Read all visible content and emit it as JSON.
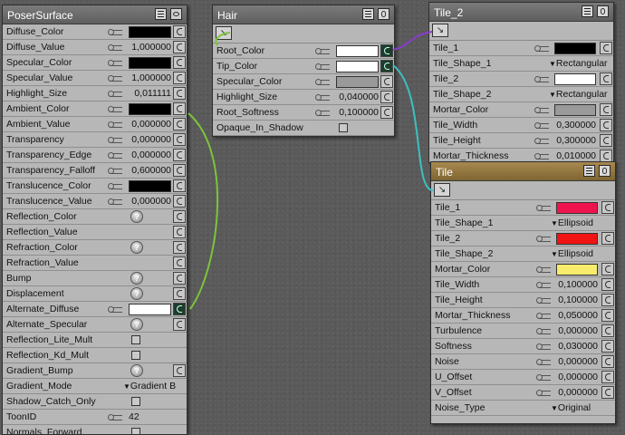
{
  "colors": {
    "wire_green": "#7cc43a",
    "wire_purple": "#8a3bd0",
    "wire_cyan": "#3cc0c0",
    "active_header": "#9a7d45"
  },
  "poser_surface": {
    "title": "PoserSurface",
    "rows": [
      {
        "label": "Diffuse_Color",
        "type": "color",
        "color": "#000000",
        "key": true,
        "port": true
      },
      {
        "label": "Diffuse_Value",
        "type": "number",
        "value": "1,000000",
        "key": true,
        "port": true
      },
      {
        "label": "Specular_Color",
        "type": "color",
        "color": "#000000",
        "key": true,
        "port": true
      },
      {
        "label": "Specular_Value",
        "type": "number",
        "value": "1,000000",
        "key": true,
        "port": true
      },
      {
        "label": "Highlight_Size",
        "type": "number",
        "value": "0,011111",
        "key": true,
        "port": true
      },
      {
        "label": "Ambient_Color",
        "type": "color",
        "color": "#000000",
        "key": true,
        "port": true
      },
      {
        "label": "Ambient_Value",
        "type": "number",
        "value": "0,000000",
        "key": true,
        "port": true
      },
      {
        "label": "Transparency",
        "type": "number",
        "value": "0,000000",
        "key": true,
        "port": true
      },
      {
        "label": "Transparency_Edge",
        "type": "number",
        "value": "0,000000",
        "key": true,
        "port": true
      },
      {
        "label": "Transparency_Falloff",
        "type": "number",
        "value": "0,600000",
        "key": true,
        "port": true
      },
      {
        "label": "Translucence_Color",
        "type": "color",
        "color": "#000000",
        "key": true,
        "port": true
      },
      {
        "label": "Translucence_Value",
        "type": "number",
        "value": "0,000000",
        "key": true,
        "port": true
      },
      {
        "label": "Reflection_Color",
        "type": "help",
        "port": true
      },
      {
        "label": "Reflection_Value",
        "type": "empty",
        "port": true
      },
      {
        "label": "Refraction_Color",
        "type": "help",
        "port": true
      },
      {
        "label": "Refraction_Value",
        "type": "empty",
        "port": true
      },
      {
        "label": "Bump",
        "type": "help",
        "port": true
      },
      {
        "label": "Displacement",
        "type": "help",
        "port": true
      },
      {
        "label": "Alternate_Diffuse",
        "type": "color",
        "color": "#ffffff",
        "key": true,
        "port": true,
        "connected": true
      },
      {
        "label": "Alternate_Specular",
        "type": "help",
        "port": true
      },
      {
        "label": "Reflection_Lite_Mult",
        "type": "checkbox"
      },
      {
        "label": "Reflection_Kd_Mult",
        "type": "checkbox"
      },
      {
        "label": "Gradient_Bump",
        "type": "help",
        "port": true
      },
      {
        "label": "Gradient_Mode",
        "type": "dropdown",
        "value": "Gradient B"
      },
      {
        "label": "Shadow_Catch_Only",
        "type": "checkbox"
      },
      {
        "label": "ToonID",
        "type": "int",
        "value": "42",
        "key": true
      },
      {
        "label": "Normals_Forward",
        "type": "checkbox"
      }
    ]
  },
  "hair": {
    "title": "Hair",
    "rows": [
      {
        "label": "Root_Color",
        "type": "color",
        "color": "#ffffff",
        "key": true,
        "port": true,
        "connected": true
      },
      {
        "label": "Tip_Color",
        "type": "color",
        "color": "#ffffff",
        "key": true,
        "port": true,
        "connected": true
      },
      {
        "label": "Specular_Color",
        "type": "color",
        "color": "#9a9a9a",
        "key": true,
        "port": true
      },
      {
        "label": "Highlight_Size",
        "type": "number",
        "value": "0,040000",
        "key": true,
        "port": true
      },
      {
        "label": "Root_Softness",
        "type": "number",
        "value": "0,100000",
        "key": true,
        "port": true
      },
      {
        "label": "Opaque_In_Shadow",
        "type": "checkbox"
      }
    ]
  },
  "tile2": {
    "title": "Tile_2",
    "rows": [
      {
        "label": "Tile_1",
        "type": "color",
        "color": "#000000",
        "key": true,
        "port": true
      },
      {
        "label": "Tile_Shape_1",
        "type": "dropdown",
        "value": "Rectangular"
      },
      {
        "label": "Tile_2",
        "type": "color",
        "color": "#ffffff",
        "key": true,
        "port": true
      },
      {
        "label": "Tile_Shape_2",
        "type": "dropdown",
        "value": "Rectangular"
      },
      {
        "label": "Mortar_Color",
        "type": "color",
        "color": "#9a9a9a",
        "key": true,
        "port": true
      },
      {
        "label": "Tile_Width",
        "type": "number",
        "value": "0,300000",
        "key": true,
        "port": true
      },
      {
        "label": "Tile_Height",
        "type": "number",
        "value": "0,300000",
        "key": true,
        "port": true
      },
      {
        "label": "Mortar_Thickness",
        "type": "number",
        "value": "0,010000",
        "key": true,
        "port": true
      }
    ]
  },
  "tile": {
    "title": "Tile",
    "rows": [
      {
        "label": "Tile_1",
        "type": "color",
        "color": "#f0144e",
        "key": true,
        "port": true
      },
      {
        "label": "Tile_Shape_1",
        "type": "dropdown",
        "value": "Ellipsoid"
      },
      {
        "label": "Tile_2",
        "type": "color",
        "color": "#f01414",
        "key": true,
        "port": true
      },
      {
        "label": "Tile_Shape_2",
        "type": "dropdown",
        "value": "Ellipsoid"
      },
      {
        "label": "Mortar_Color",
        "type": "color",
        "color": "#f8ec6c",
        "key": true,
        "port": true
      },
      {
        "label": "Tile_Width",
        "type": "number",
        "value": "0,100000",
        "key": true,
        "port": true
      },
      {
        "label": "Tile_Height",
        "type": "number",
        "value": "0,100000",
        "key": true,
        "port": true
      },
      {
        "label": "Mortar_Thickness",
        "type": "number",
        "value": "0,050000",
        "key": true,
        "port": true
      },
      {
        "label": "Turbulence",
        "type": "number",
        "value": "0,000000",
        "key": true,
        "port": true
      },
      {
        "label": "Softness",
        "type": "number",
        "value": "0,030000",
        "key": true,
        "port": true
      },
      {
        "label": "Noise",
        "type": "number",
        "value": "0,000000",
        "key": true,
        "port": true
      },
      {
        "label": "U_Offset",
        "type": "number",
        "value": "0,000000",
        "key": true,
        "port": true
      },
      {
        "label": "V_Offset",
        "type": "number",
        "value": "0,000000",
        "key": true,
        "port": true
      },
      {
        "label": "Noise_Type",
        "type": "dropdown",
        "value": "Original"
      }
    ]
  }
}
